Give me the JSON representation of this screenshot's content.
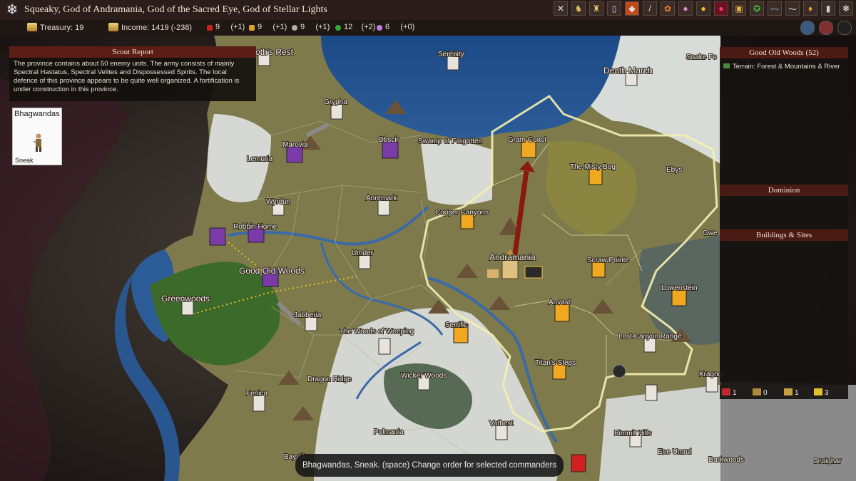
{
  "title_bar": {
    "title": "Squeaky, God of Andramania, God of the Sacred Eye, God of Stellar Lights",
    "menu_icon": "snowflake-icon",
    "icons": [
      "crossed-swords-icon",
      "army-icon",
      "castle-icon",
      "scroll-icon",
      "fire-gem-icon",
      "feather-icon",
      "magic-map-icon",
      "brain-icon",
      "sun-icon",
      "blood-icon",
      "chest-icon",
      "globe-icon",
      "water-icon",
      "wind-icon",
      "candle-icon",
      "tombstone-icon",
      "snowflake-icon"
    ]
  },
  "resources": {
    "treasury": "Treasury: 19",
    "income": "Income: 1419 (-238)",
    "items": [
      {
        "icon": "fire-gem-icon",
        "value": "9",
        "delta": "(+1)",
        "color": "#d02020"
      },
      {
        "icon": "air-gem-icon",
        "value": "9",
        "delta": "(+1)",
        "color": "#e0a030"
      },
      {
        "icon": "earth-gem-icon",
        "value": "9",
        "delta": "(+1)",
        "color": "#b0b0b0"
      },
      {
        "icon": "nature-gem-icon",
        "value": "12",
        "delta": "(+2)",
        "color": "#30b030"
      },
      {
        "icon": "astral-pearl-icon",
        "value": "6",
        "delta": "(+0)",
        "color": "#c080e0"
      }
    ]
  },
  "scout_report": {
    "header": "Scout Report",
    "text": "The province contains about 50 enemy units. The army consists of mainly Spectral Hastatus, Spectral Velites and Dispossessed Spirits. The local defence of this province appears to be quite well organized. A fortification is under construction in this province."
  },
  "commander": {
    "name": "Bhagwandas",
    "order": "Sneak"
  },
  "province_panel": {
    "title": "Good Old Woods (52)",
    "terrain": "Terrain: Forest & Mountains & River",
    "dominion_header": "Dominion",
    "buildings_header": "Buildings & Sites"
  },
  "unit_counts": [
    {
      "icon": "red-banner-icon",
      "value": "1"
    },
    {
      "icon": "gold-helm-icon",
      "value": "0"
    },
    {
      "icon": "gold-sword-icon",
      "value": "1"
    },
    {
      "icon": "yellow-arrow-icon",
      "value": "3"
    }
  ],
  "status": "Bhagwandas, Sneak.  (space) Change order for selected commanders",
  "map": {
    "provinces": [
      "Behemoth's Rest",
      "Serenity",
      "Death March",
      "Snake Fo",
      "Grypha",
      "Marovia",
      "Obscir",
      "Swamp of Forgotten",
      "Gram Coast",
      "The Misty Bog",
      "Ebys",
      "Lemuria",
      "Anremark",
      "Copper Canyons",
      "Wyrdun",
      "Robbin Home",
      "Good Old Woods",
      "Umder",
      "Andramania",
      "Scraw Pointe",
      "Greenwoods",
      "Jabberia",
      "The Woods of Weeping",
      "Serrific",
      "Anvast",
      "Lowenstein",
      "Lost Canyon Range",
      "Titan's Steps",
      "Dragon Ridge",
      "Wicker Woods",
      "Fenica",
      "Polmania",
      "Vatbest",
      "Bimmit Hills",
      "Ene Umrul",
      "Darkwoods",
      "Droighar",
      "Kragnor",
      "Bayville",
      "Gwe"
    ]
  }
}
